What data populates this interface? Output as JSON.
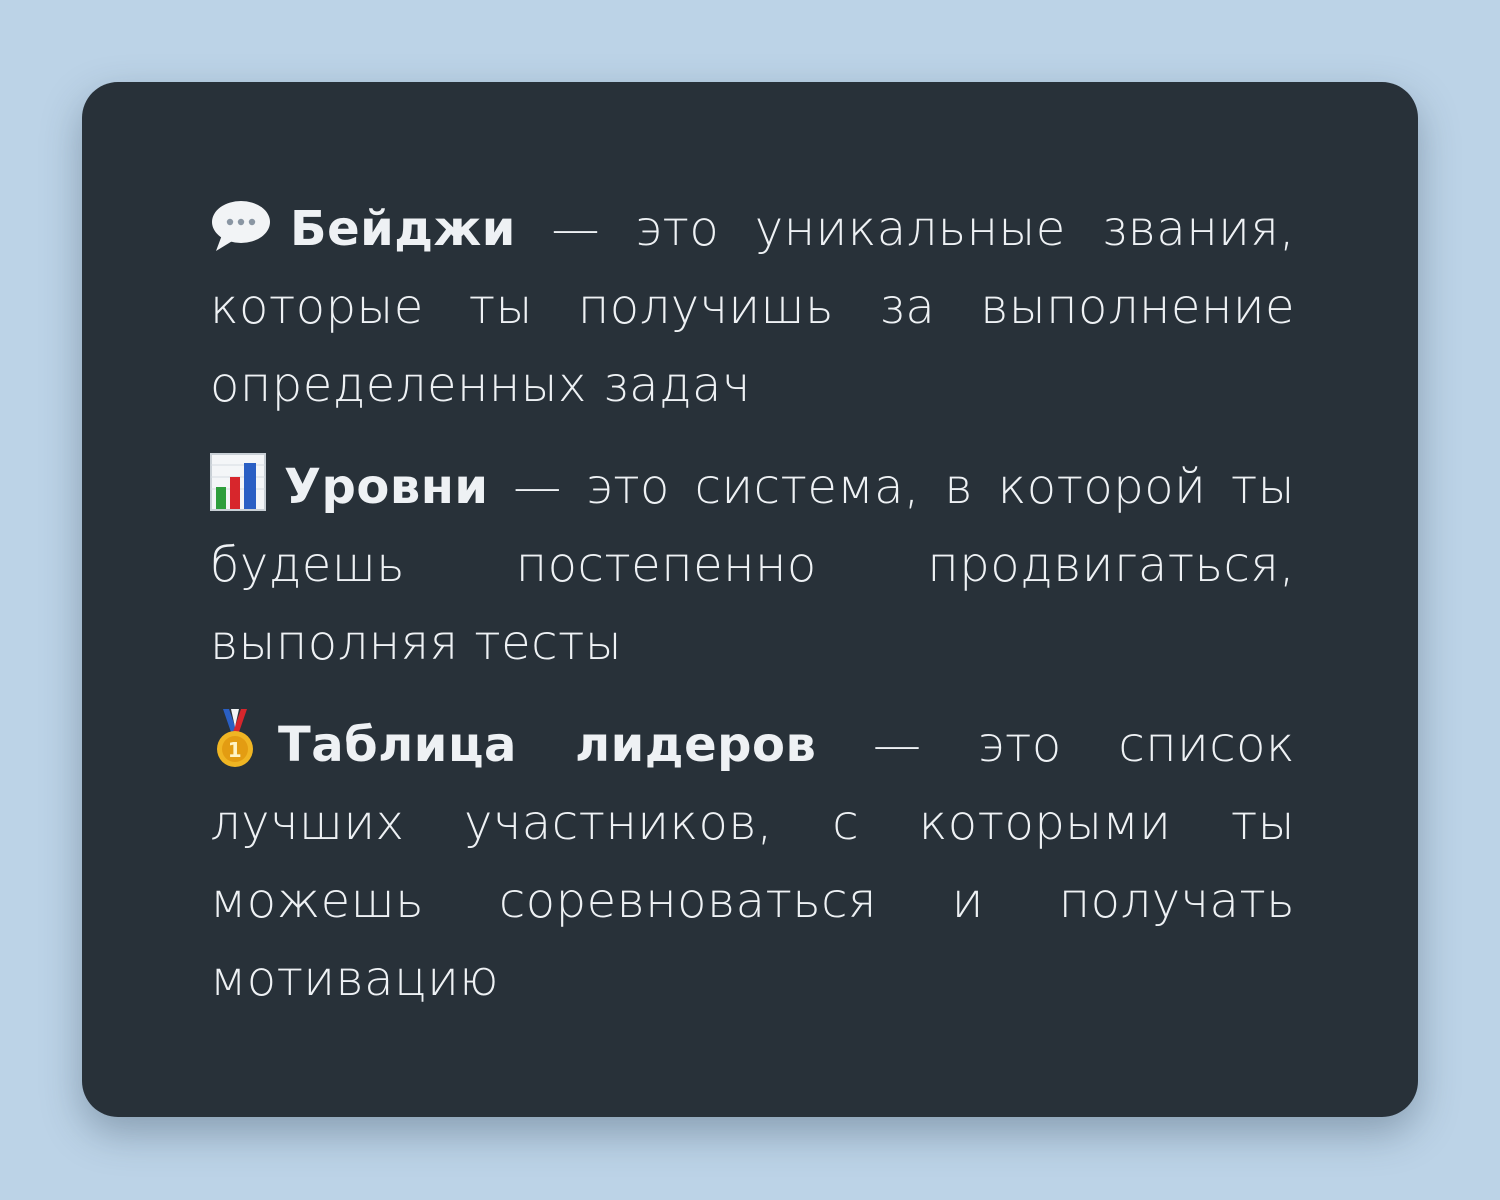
{
  "items": [
    {
      "icon": "speech-bubble-icon",
      "term": "Бейджи",
      "text": " — это уникальные звания, которые ты получишь за выполнение определенных задач"
    },
    {
      "icon": "bar-chart-icon",
      "term": "Уровни",
      "text": " — это система, в которой ты будешь постепенно продвигаться, выполняя тесты"
    },
    {
      "icon": "medal-icon",
      "term": "Таблица лидеров",
      "text": " — это список лучших участников, с которыми ты можешь соревноваться и получать мотивацию"
    }
  ],
  "colors": {
    "background": "#bcd3e7",
    "card": "#283139",
    "text": "#eef1f4"
  }
}
